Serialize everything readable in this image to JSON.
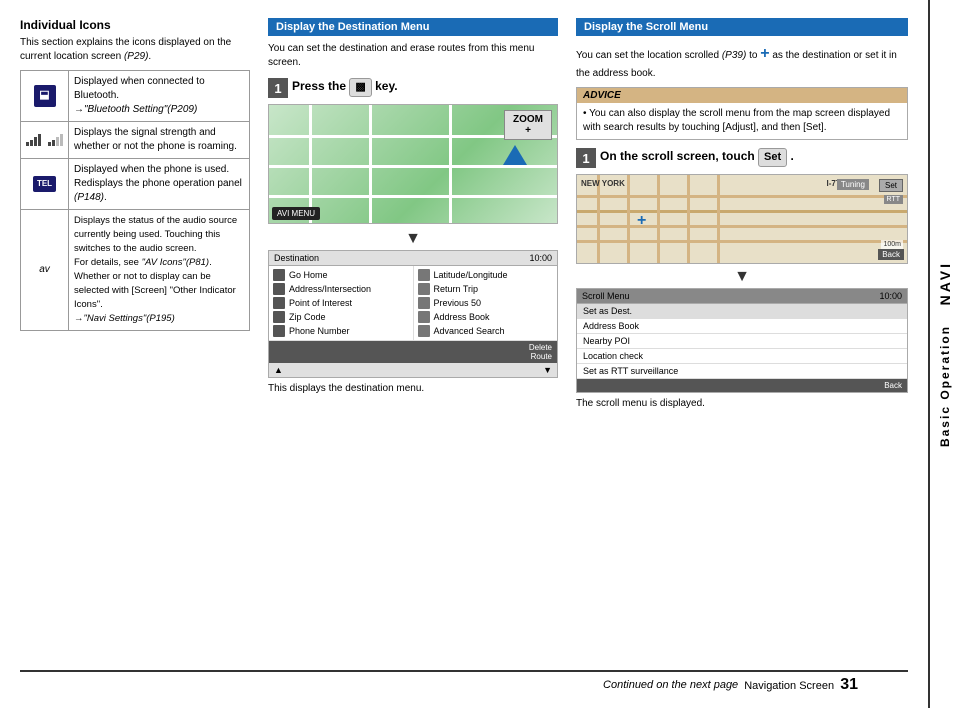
{
  "page": {
    "title": "Navigation Screen",
    "page_number": "31",
    "continued_text": "Continued on the next page",
    "page_label": "Navigation Screen"
  },
  "sidebar": {
    "navi_label": "NAVI",
    "basic_label": "Basic Operation"
  },
  "left_section": {
    "title": "Individual Icons",
    "intro": "This section explains the icons displayed on the current location screen (P29).",
    "intro_ref": "(P29)",
    "rows": [
      {
        "icon_type": "bluetooth",
        "text": "Displayed when connected to Bluetooth.\n→\"Bluetooth Setting\"(P209)"
      },
      {
        "icon_type": "signal",
        "text": "Displays the signal strength and whether or not the phone is roaming."
      },
      {
        "icon_type": "tel",
        "text": "Displayed when the phone is used.\nRedisplays the phone operation panel (P148)."
      },
      {
        "icon_type": "av",
        "text": "Displays the status of the audio source currently being used. Touching this switches to the audio screen.\nFor details, see \"AV Icons\"(P81).\nWhether or not to display can be selected with [Screen] \"Other Indicator Icons\".\n→\"Navi Settings\"(P195)"
      }
    ],
    "bluetooth_ref": "→\"Bluetooth Setting\"(P209)",
    "tel_ref": "(P148)",
    "av_ref1": "\"AV Icons\"(P81)",
    "av_ref2": "→\"Navi Settings\"(P195)"
  },
  "mid_section": {
    "title": "Display the Destination Menu",
    "intro": "You can set the destination and erase routes from this menu screen.",
    "step1": {
      "number": "1",
      "text": "Press the",
      "key": "MENU",
      "key_suffix": "key."
    },
    "map_zoom": "ZOOM\n+",
    "avi_menu_label": "AVI MENU",
    "caption": "This displays the destination menu.",
    "dest_menu": {
      "header_left": "Destination",
      "header_right": "10:00",
      "items_left": [
        "Go Home",
        "Address/Intersection",
        "Point of Interest",
        "Zip Code",
        "Phone Number"
      ],
      "items_right": [
        "Latitude/Longitude",
        "Return Trip",
        "Previous 50",
        "Address Book",
        "Advanced Search"
      ],
      "footer": "Delete Route"
    }
  },
  "right_section": {
    "title": "Display the Scroll Menu",
    "intro": "You can set the location scrolled (P39) to",
    "cross_symbol": "+",
    "intro2": "as the destination or set it in the address book.",
    "advice": {
      "title": "ADVICE",
      "text": "You can also display the scroll menu from the map screen displayed with search results by touching [Adjust], and then [Set]."
    },
    "step1": {
      "number": "1",
      "text": "On the scroll screen, touch",
      "set_btn": "Set",
      "set_suffix": "."
    },
    "map": {
      "city": "NEW YORK",
      "tuning_btn": "Tuning",
      "set_btn": "Set",
      "rtt_label": "RTT",
      "back_btn": "Back",
      "scale": "100m"
    },
    "scroll_menu": {
      "items": [
        "Scroll Menu",
        "Set as Dest.",
        "Address Book",
        "Nearby POI",
        "Location check",
        "Set as RTT surveillance"
      ],
      "back_btn": "Back",
      "time": "10:00"
    },
    "caption": "The scroll menu is displayed."
  }
}
